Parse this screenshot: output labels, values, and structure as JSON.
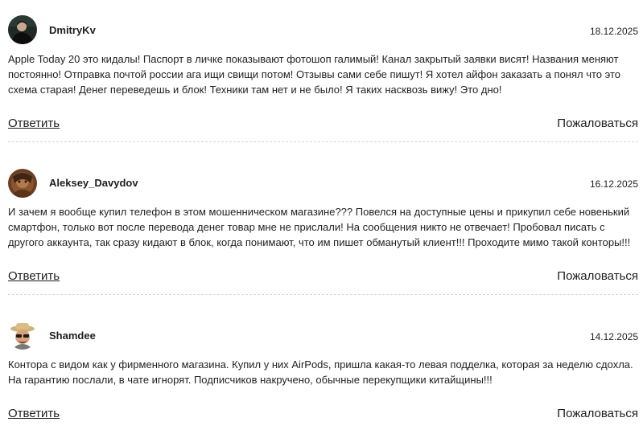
{
  "reviews": [
    {
      "author": "DmitryKv",
      "date": "18.12.2025",
      "text": "Apple Today 20 это кидалы! Паспорт в личке показывают фотошоп галимый! Канал закрытый заявки висят! Названия меняют постоянно! Отправка почтой россии ага ищи свищи потом! Отзывы сами себе пишут! Я хотел айфон заказать а понял что это схема старая! Денег переведешь и блок! Техники там нет и не было! Я таких насквозь вижу! Это дно!",
      "reply_label": "Ответить",
      "report_label": "Пожаловаться"
    },
    {
      "author": "Aleksey_Davydov",
      "date": "16.12.2025",
      "text": "И зачем я вообще купил телефон в этом мошенническом магазине??? Повелся на доступные цены и прикупил себе новенький смартфон, только вот после перевода денег товар мне не прислали! На сообщения никто не отвечает! Пробовал писать с другого аккаунта, так сразу кидают в блок, когда понимают, что им пишет обманутый клиент!!! Проходите мимо такой конторы!!!",
      "reply_label": "Ответить",
      "report_label": "Пожаловаться"
    },
    {
      "author": "Shamdee",
      "date": "14.12.2025",
      "text": "Контора с видом как у фирменного магазина. Купил у них AirPods, пришла какая-то левая подделка, которая за неделю сдохла. На гарантию послали, в чате игнорят. Подписчиков накручено, обычные перекупщики китайщины!!!",
      "reply_label": "Ответить",
      "report_label": "Пожаловаться"
    }
  ]
}
